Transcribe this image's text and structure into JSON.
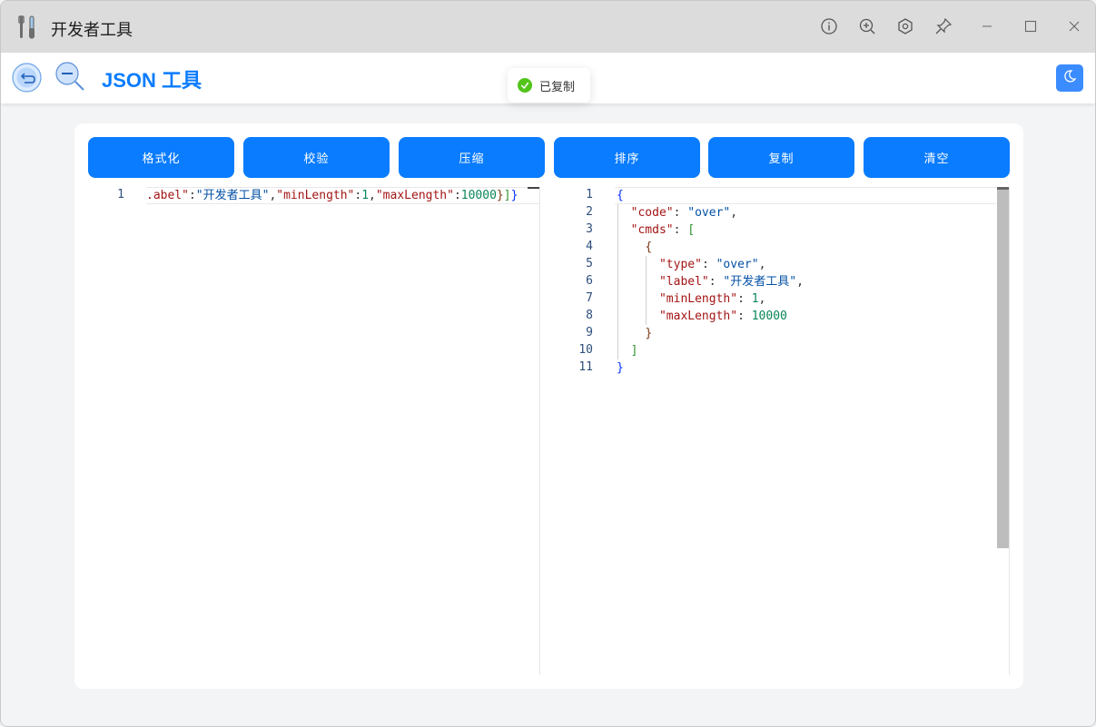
{
  "app": {
    "title": "开发者工具",
    "icon": "tools-icon"
  },
  "titlebar_buttons": [
    "info-icon",
    "zoom-in-icon",
    "settings-hex-icon",
    "pin-icon",
    "minimize-icon",
    "maximize-icon",
    "close-icon"
  ],
  "header": {
    "title": "JSON 工具",
    "back_icon": "back-icon",
    "zoom_icon": "zoom-out-icon",
    "theme_icon": "moon-icon"
  },
  "toast": {
    "text": "已复制",
    "icon": "check-circle-icon"
  },
  "toolbar": {
    "buttons": [
      "格式化",
      "校验",
      "压缩",
      "排序",
      "复制",
      "清空"
    ]
  },
  "left_editor": {
    "lines": [
      "1"
    ],
    "content": ".abel\":\"开发者工具\",\"minLength\":1,\"maxLength\":10000}]}"
  },
  "right_editor": {
    "line_numbers": [
      "1",
      "2",
      "3",
      "4",
      "5",
      "6",
      "7",
      "8",
      "9",
      "10",
      "11"
    ]
  },
  "colors": {
    "accent": "#0a7cff",
    "titlebar": "#dcdcdc",
    "success": "#52c41a"
  }
}
